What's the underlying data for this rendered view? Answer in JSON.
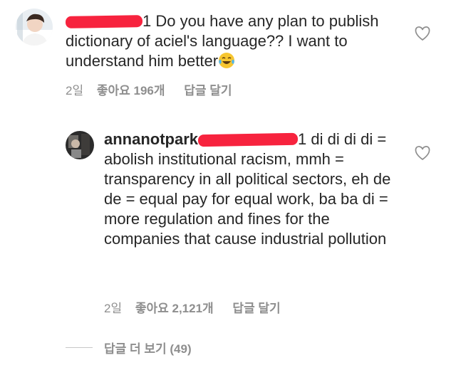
{
  "comments": [
    {
      "username": "",
      "body_prefix_redacted_suffix": "1",
      "body": " Do you have any plan to publish dictionary of aciel's language?? I want to understand him better",
      "emoji": "laughing-tears-emoji",
      "time": "2일",
      "likes": "좋아요 196개",
      "reply_label": "답글 달기"
    },
    {
      "username": "annanotpark",
      "body_prefix_redacted_suffix": "1",
      "body": " di di di di = abolish institutional racism, mmh = transparency in all political sectors, eh de de = equal pay for equal work, ba ba di = more regulation and fines for the companies that cause industrial pollution",
      "time": "2일",
      "likes": "좋아요 2,121개",
      "reply_label": "답글 달기"
    }
  ],
  "more_replies_label": "답글 더 보기 (49)",
  "colors": {
    "text": "#262626",
    "meta": "#8e8e8e",
    "redaction": "#f7233e",
    "heart_stroke": "#8e8e8e"
  }
}
